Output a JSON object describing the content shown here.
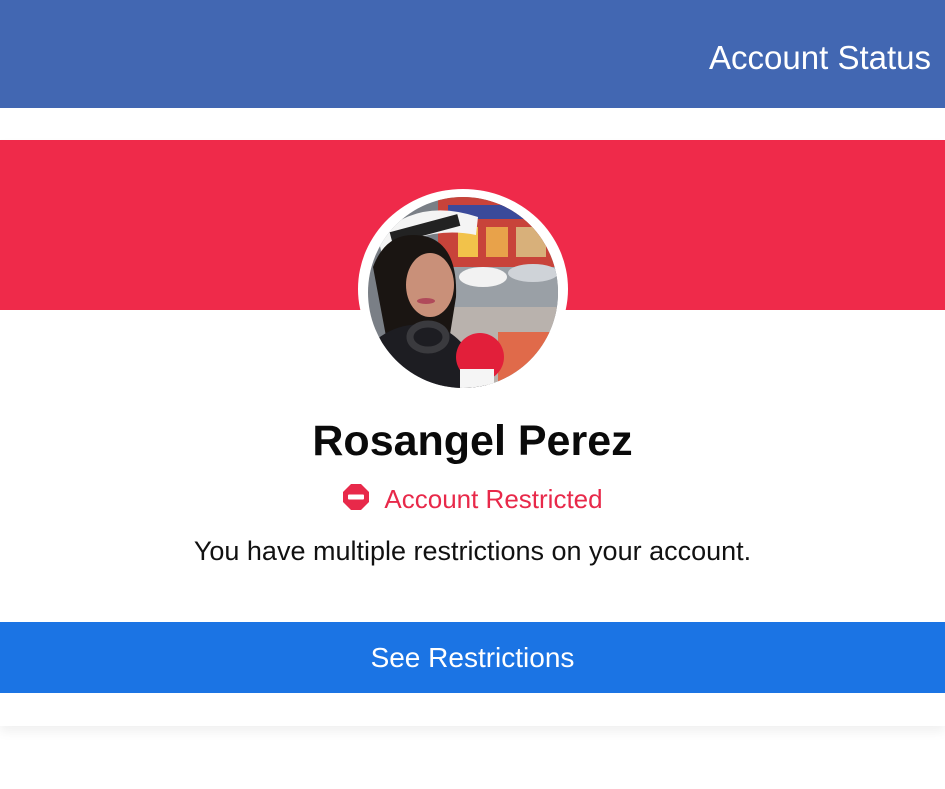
{
  "header": {
    "title": "Account Status",
    "color": "#4267b2"
  },
  "profile": {
    "name": "Rosangel Perez",
    "banner_color": "#ef2a4a",
    "avatar_icon": "profile-photo"
  },
  "status": {
    "icon": "no-entry-icon",
    "label": "Account Restricted",
    "color": "#e8294a",
    "message": "You have multiple restrictions on your account."
  },
  "actions": {
    "see_restrictions_label": "See Restrictions",
    "button_color": "#1b74e4"
  }
}
